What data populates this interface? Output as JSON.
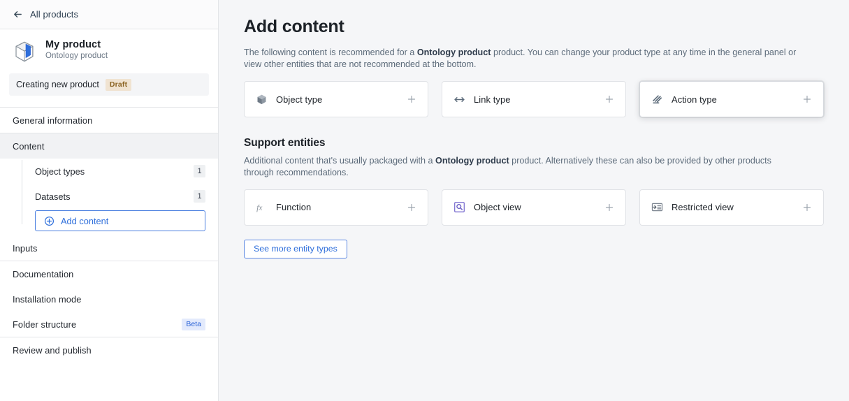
{
  "sidebar": {
    "back": {
      "label": "All products",
      "icon": "arrow-left-icon"
    },
    "product": {
      "icon": "product-box-icon",
      "name": "My product",
      "subtitle": "Ontology product"
    },
    "status": {
      "text": "Creating new product",
      "badge": "Draft"
    },
    "nav": [
      {
        "label": "General information",
        "type": "item",
        "active": false
      },
      {
        "label": "Content",
        "type": "item",
        "active": true
      },
      {
        "label": "Object types",
        "type": "sub",
        "count": "1"
      },
      {
        "label": "Datasets",
        "type": "sub",
        "count": "1"
      },
      {
        "label": "Add content",
        "type": "button",
        "icon": "plus-circle-icon"
      },
      {
        "label": "Inputs",
        "type": "item",
        "active": false
      },
      {
        "label": "Documentation",
        "type": "item",
        "active": false
      },
      {
        "label": "Installation mode",
        "type": "item",
        "active": false
      },
      {
        "label": "Folder structure",
        "type": "item",
        "active": false,
        "badge": "Beta"
      },
      {
        "label": "Review and publish",
        "type": "item",
        "active": false
      }
    ]
  },
  "main": {
    "title": "Add content",
    "intro": {
      "before": "The following content is recommended for a ",
      "bold": "Ontology product",
      "after": " product. You can change your product type at any time in the general panel or view other entities that are not recommended at the bottom."
    },
    "primary_cards": [
      {
        "label": "Object type",
        "icon": "cube-icon",
        "add": "+",
        "focused": false
      },
      {
        "label": "Link type",
        "icon": "double-arrow-icon",
        "add": "+",
        "focused": false
      },
      {
        "label": "Action type",
        "icon": "action-strikes-icon",
        "add": "+",
        "focused": true
      }
    ],
    "support": {
      "title": "Support entities",
      "desc": {
        "before": "Additional content that's usually packaged with a ",
        "bold": "Ontology product",
        "after": " product. Alternatively these can also be provided by other products through recommendations."
      },
      "cards": [
        {
          "label": "Function",
          "icon": "fx-icon",
          "add": "+"
        },
        {
          "label": "Object view",
          "icon": "object-view-search-icon",
          "add": "+"
        },
        {
          "label": "Restricted view",
          "icon": "restricted-view-icon",
          "add": "+"
        }
      ]
    },
    "see_more_label": "See more entity types"
  },
  "colors": {
    "accent_blue": "#2f6fdb",
    "draft_badge_bg": "#f0e3d1",
    "draft_badge_text": "#8a6220",
    "beta_badge_bg": "#e3eafc",
    "beta_badge_text": "#2a62d6",
    "page_bg": "#f5f6f8"
  }
}
